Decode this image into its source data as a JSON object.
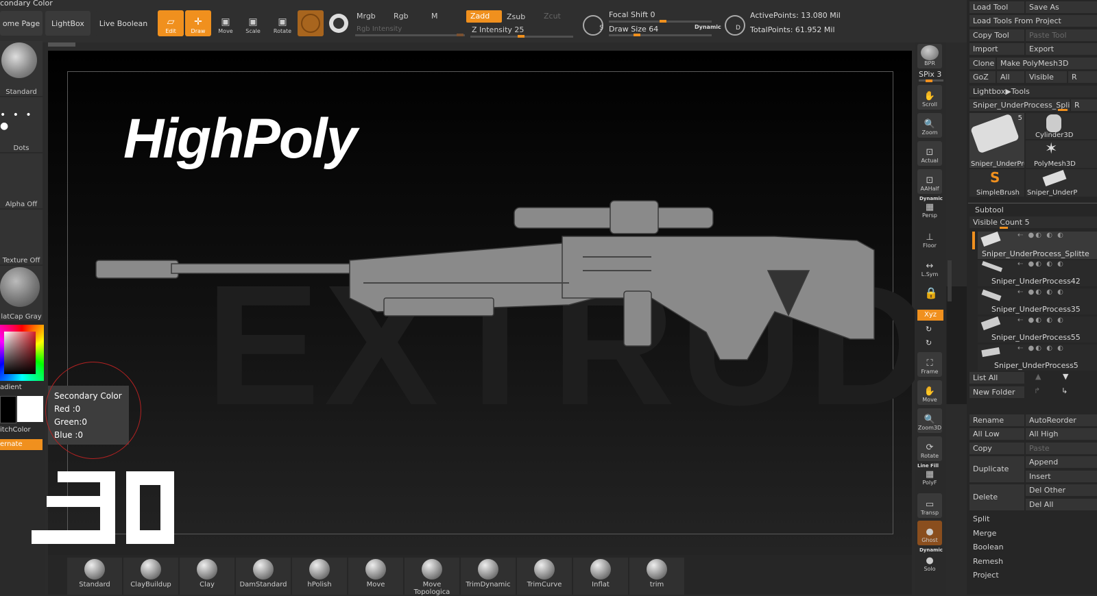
{
  "header": {
    "secondary_color_label": "condary Color",
    "home_page": "ome Page",
    "lightbox": "LightBox",
    "live_boolean": "Live Boolean",
    "tools": [
      {
        "label": "Edit",
        "icon": "edit-icon"
      },
      {
        "label": "Draw",
        "icon": "draw-icon"
      },
      {
        "label": "Move",
        "icon": "move-icon"
      },
      {
        "label": "Scale",
        "icon": "scale-icon"
      },
      {
        "label": "Rotate",
        "icon": "rotate-icon"
      }
    ],
    "modes": {
      "mrgb": "Mrgb",
      "rgb": "Rgb",
      "m": "M",
      "zadd": "Zadd",
      "zsub": "Zsub",
      "zcut": "Zcut"
    },
    "rgb_intensity": "Rgb Intensity",
    "z_intensity": "Z Intensity 25",
    "focal_shift": "Focal Shift 0",
    "draw_size": "Draw Size 64",
    "dynamic": "Dynamic",
    "active_points": "ActivePoints: 13.080 Mil",
    "total_points": "TotalPoints: 61.952 Mil"
  },
  "left_panel": {
    "items": [
      "Standard",
      "Dots",
      "Alpha Off",
      "Texture Off",
      "latCap Gray"
    ],
    "gradient": "adient",
    "switch_color": "itchColor",
    "alternate": "ernate"
  },
  "tooltip": {
    "title": "Secondary Color",
    "red": "Red  :0",
    "green": "Green:0",
    "blue": "Blue :0"
  },
  "canvas": {
    "title": "HighPoly",
    "watermark": "EXTRUDE"
  },
  "right_bar": {
    "spix": "SPix 3",
    "buttons": [
      "BPR",
      "Scroll",
      "Zoom",
      "Actual",
      "AAHalf",
      "Persp",
      "Floor",
      "L.Sym",
      "Xyz",
      "Frame",
      "Move",
      "Zoom3D",
      "Rotate",
      "PolyF",
      "Transp",
      "Ghost",
      "Solo"
    ],
    "dynamic": "Dynamic",
    "line_fill": "Line Fill"
  },
  "tool_panel": {
    "load_tool": "Load Tool",
    "save_as": "Save As",
    "load_from_project": "Load Tools From Project",
    "copy_tool": "Copy Tool",
    "paste_tool": "Paste Tool",
    "import": "Import",
    "export": "Export",
    "clone": "Clone",
    "make_polymesh": "Make PolyMesh3D",
    "goz": "GoZ",
    "all": "All",
    "visible": "Visible",
    "r": "R",
    "lightbox_tools": "Lightbox▶Tools",
    "current_tool": "Sniper_UnderProcess_Splitte",
    "thumb_count": "5",
    "thumbs": [
      "Sniper_UnderPro",
      "Cylinder3D",
      "PolyMesh3D",
      "SimpleBrush",
      "Sniper_UnderP"
    ],
    "subtool": "Subtool",
    "visible_count": "Visible Count 5",
    "subtools": [
      "Sniper_UnderProcess_Splitte",
      "Sniper_UnderProcess42",
      "Sniper_UnderProcess35",
      "Sniper_UnderProcess55",
      "Sniper_UnderProcess5"
    ],
    "list_all": "List All",
    "new_folder": "New Folder",
    "rename": "Rename",
    "auto_reorder": "AutoReorder",
    "all_low": "All Low",
    "all_high": "All High",
    "copy": "Copy",
    "paste": "Paste",
    "duplicate": "Duplicate",
    "append": "Append",
    "insert": "Insert",
    "delete": "Delete",
    "del_other": "Del Other",
    "del_all": "Del All",
    "split": "Split",
    "merge": "Merge",
    "boolean": "Boolean",
    "remesh": "Remesh",
    "project": "Project"
  },
  "brushes": [
    "Standard",
    "ClayBuildup",
    "Clay",
    "DamStandard",
    "hPolish",
    "Move",
    "Move Topologica",
    "TrimDynamic",
    "TrimCurve",
    "Inflat",
    "trim"
  ],
  "colors": {
    "accent": "#f0901e",
    "bg": "#2b2b2b"
  }
}
